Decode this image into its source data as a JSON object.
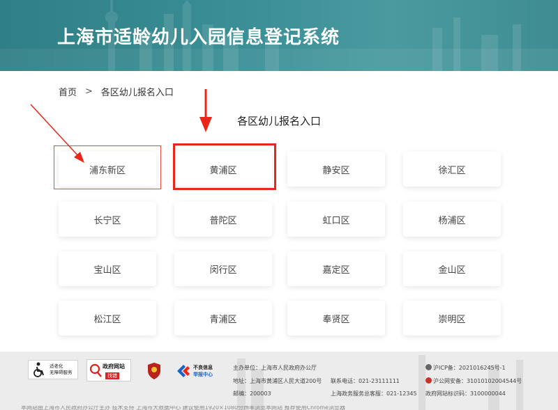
{
  "header": {
    "title": "上海市适龄幼儿入园信息登记系统",
    "bg_color": "#3b8f96"
  },
  "breadcrumb": {
    "home": "首页",
    "separator": ">",
    "current": "各区幼儿报名入口"
  },
  "section": {
    "title": "各区幼儿报名入口"
  },
  "districts": [
    "浦东新区",
    "黄浦区",
    "静安区",
    "徐汇区",
    "长宁区",
    "普陀区",
    "虹口区",
    "杨浦区",
    "宝山区",
    "闵行区",
    "嘉定区",
    "金山区",
    "松江区",
    "青浦区",
    "奉贤区",
    "崇明区"
  ],
  "annotations": {
    "highlight_color": "#e8261a"
  },
  "footer": {
    "logos": {
      "a11y_line1": "适老化",
      "a11y_line2": "无障碍服务",
      "gov_top": "政府网站",
      "gov_bottom": "找错",
      "report_line1": "不良信息",
      "report_line2": "举报中心"
    },
    "host": "主办单位：上海市人民政府办公厅",
    "address": "地址：上海市黄浦区人民大道200号",
    "phone": "联系电话：021-23111111",
    "postcode": "邮编：200003",
    "service": "上海政务服务总客服：021-12345",
    "icp": "沪ICP备：2021016245号-1",
    "police": "沪公网安备：31010102004544号",
    "site_id": "政府网站标识码：3100000044",
    "bottom_line": "本网站由上海市人民政府办公厅主办 技术支持 上海市大数据中心 建议使用1920×1080分辨率浏览本网站 推荐使用Chrome浏览器"
  }
}
